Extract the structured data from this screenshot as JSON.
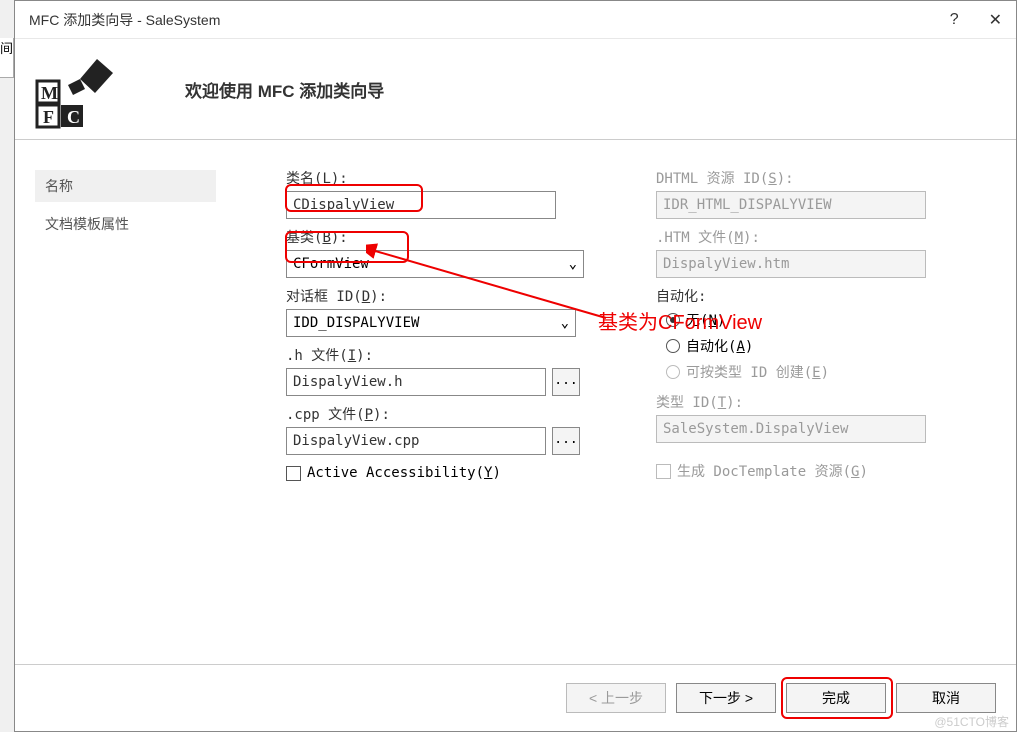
{
  "titlebar": {
    "title": "MFC 添加类向导 - SaleSystem"
  },
  "header": {
    "welcome": "欢迎使用  MFC 添加类向导"
  },
  "sidebar": {
    "items": [
      {
        "label": "名称",
        "active": true
      },
      {
        "label": "文档模板属性",
        "active": false
      }
    ]
  },
  "left_col": {
    "class_name_label": "类名(L):",
    "class_name_value": "CDispalyView",
    "base_class_label": "基类(B):",
    "base_class_value": "CFormView",
    "dialog_id_label": "对话框 ID(D):",
    "dialog_id_value": "IDD_DISPALYVIEW",
    "h_file_label": ".h 文件(I):",
    "h_file_value": "DispalyView.h",
    "cpp_file_label": ".cpp 文件(P):",
    "cpp_file_value": "DispalyView.cpp",
    "accessibility_label": "Active Accessibility(Y)",
    "browse": "..."
  },
  "right_col": {
    "dhtml_res_label": "DHTML 资源 ID(S):",
    "dhtml_res_value": "IDR_HTML_DISPALYVIEW",
    "htm_file_label": ".HTM 文件(M):",
    "htm_file_value": "DispalyView.htm",
    "automation_label": "自动化:",
    "radio_none": "无(N)",
    "radio_auto": "自动化(A)",
    "radio_typeid": "可按类型 ID 创建(E)",
    "type_id_label": "类型 ID(T):",
    "type_id_value": "SaleSystem.DispalyView",
    "gen_doctemplate": "生成 DocTemplate 资源(G)"
  },
  "footer": {
    "prev": "< 上一步",
    "next": "下一步 >",
    "finish": "完成",
    "cancel": "取消"
  },
  "annotation": {
    "text": "基类为CFormView"
  },
  "watermark": "@51CTO博客"
}
